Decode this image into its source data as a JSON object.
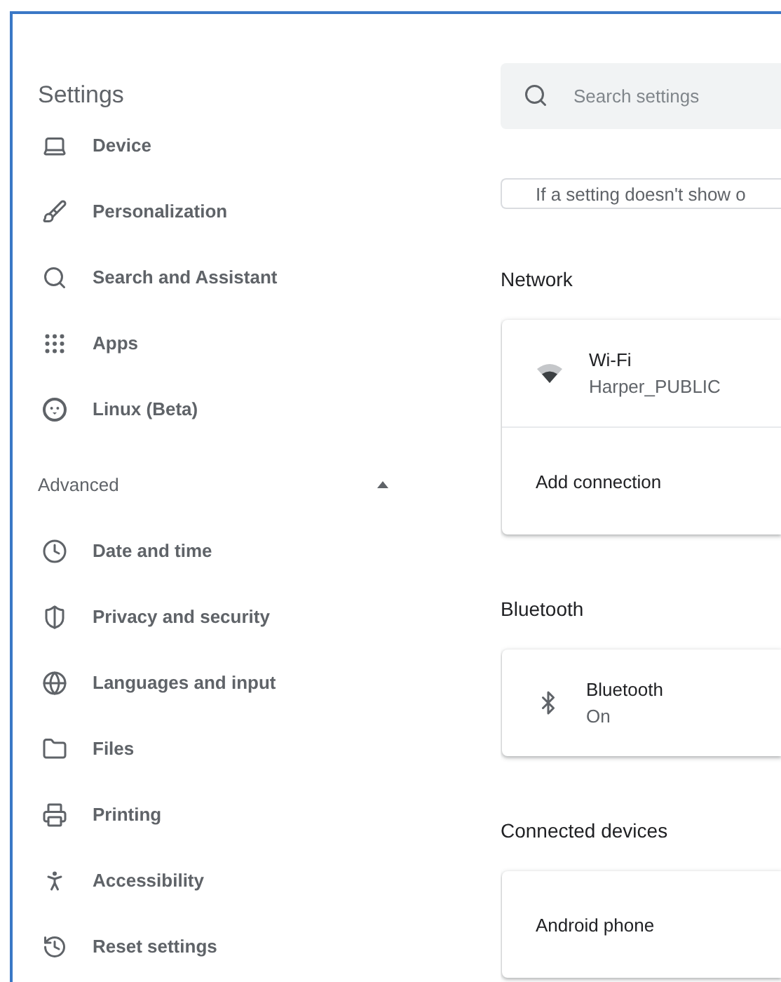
{
  "sidebar": {
    "title": "Settings",
    "items": [
      {
        "label": "Device"
      },
      {
        "label": "Personalization"
      },
      {
        "label": "Search and Assistant"
      },
      {
        "label": "Apps"
      },
      {
        "label": "Linux (Beta)"
      }
    ],
    "advanced": {
      "label": "Advanced",
      "expanded": true,
      "items": [
        {
          "label": "Date and time"
        },
        {
          "label": "Privacy and security"
        },
        {
          "label": "Languages and input"
        },
        {
          "label": "Files"
        },
        {
          "label": "Printing"
        },
        {
          "label": "Accessibility"
        },
        {
          "label": "Reset settings"
        }
      ]
    }
  },
  "search": {
    "placeholder": "Search settings"
  },
  "notice": "If a setting doesn't show o",
  "sections": [
    {
      "heading": "Network",
      "rows": [
        {
          "kind": "network",
          "title": "Wi-Fi",
          "subtitle": "Harper_PUBLIC"
        },
        {
          "kind": "action",
          "title": "Add connection"
        }
      ]
    },
    {
      "heading": "Bluetooth",
      "rows": [
        {
          "kind": "bluetooth",
          "title": "Bluetooth",
          "subtitle": "On"
        }
      ]
    },
    {
      "heading": "Connected devices",
      "rows": [
        {
          "kind": "action",
          "title": "Android phone"
        }
      ]
    }
  ]
}
